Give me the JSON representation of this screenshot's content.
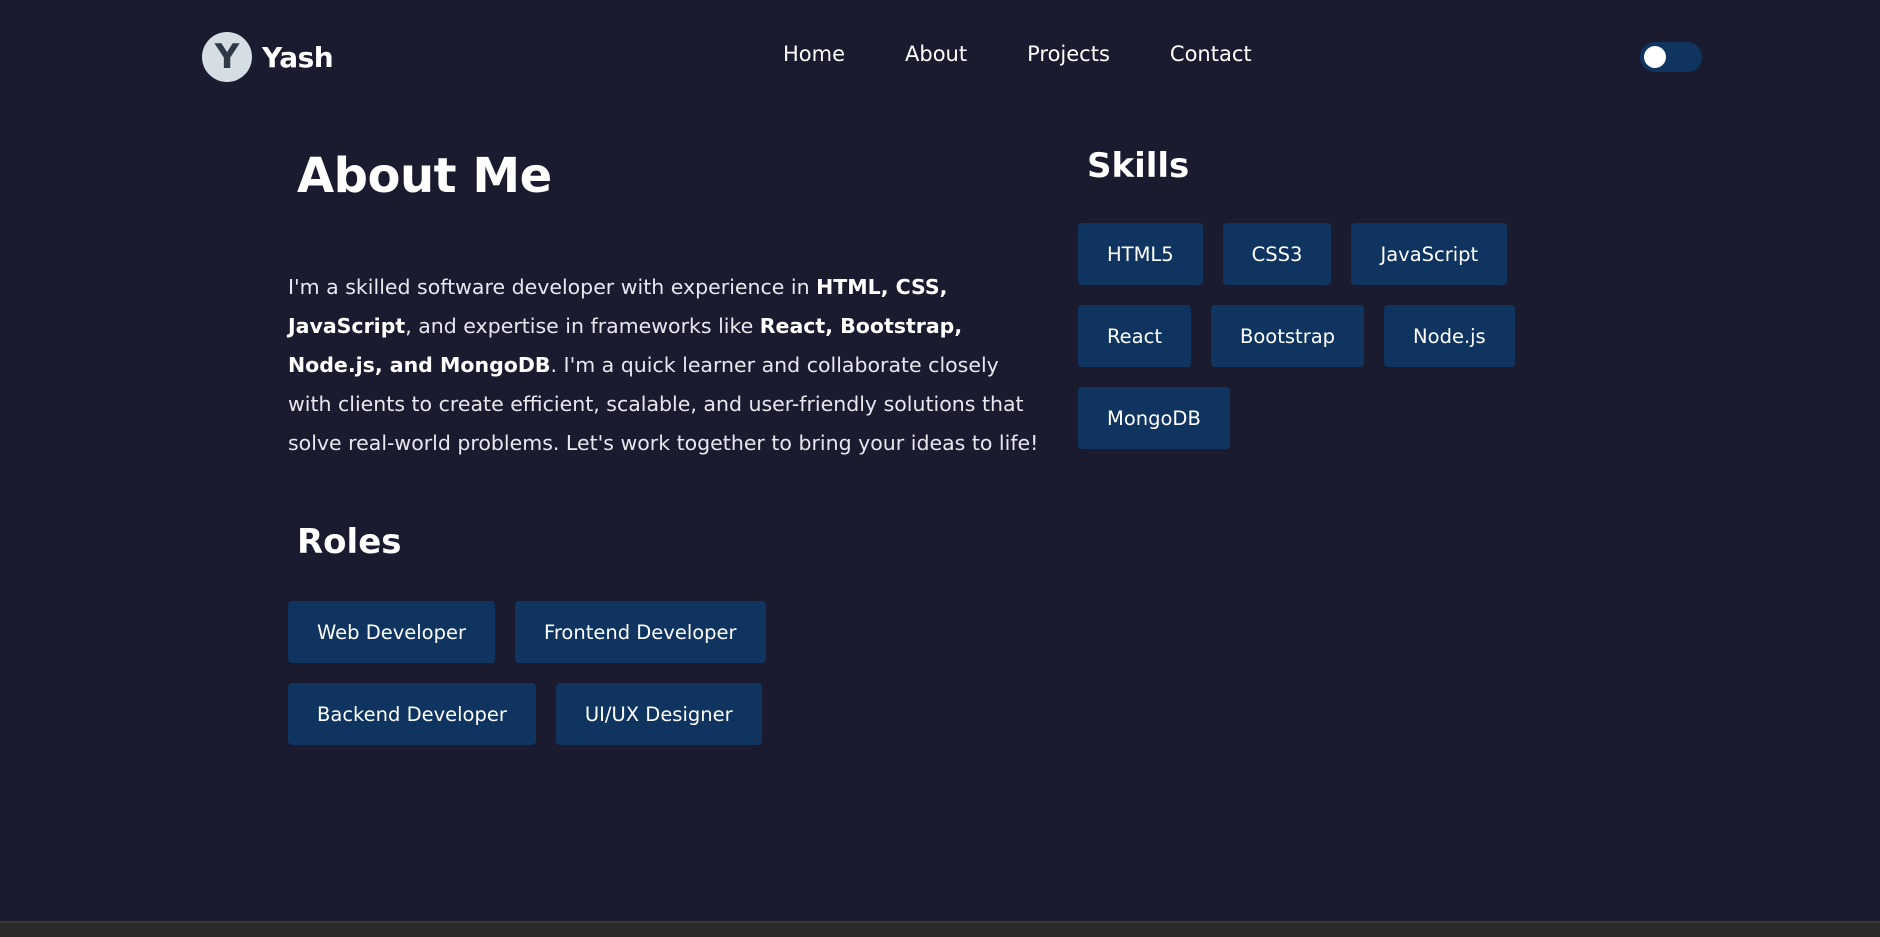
{
  "brand": {
    "logo_letter": "Y",
    "name": "Yash"
  },
  "nav": {
    "links": [
      {
        "label": "Home"
      },
      {
        "label": "About"
      },
      {
        "label": "Projects"
      },
      {
        "label": "Contact"
      }
    ],
    "theme_toggle": {
      "state": "off"
    }
  },
  "about": {
    "title": "About Me",
    "paragraph": [
      {
        "text": "I'm a skilled software developer with experience in ",
        "bold": false
      },
      {
        "text": "HTML, CSS, JavaScript",
        "bold": true
      },
      {
        "text": ", and expertise in frameworks like ",
        "bold": false
      },
      {
        "text": "React, Bootstrap, Node.js, and MongoDB",
        "bold": true
      },
      {
        "text": ". I'm a quick learner and collaborate closely with clients to create efficient, scalable, and user-friendly solutions that solve real-world problems. Let's work together to bring your ideas to life!",
        "bold": false
      }
    ]
  },
  "roles": {
    "title": "Roles",
    "items": [
      "Web Developer",
      "Frontend Developer",
      "Backend Developer",
      "UI/UX Designer"
    ]
  },
  "skills": {
    "title": "Skills",
    "items": [
      "HTML5",
      "CSS3",
      "JavaScript",
      "React",
      "Bootstrap",
      "Node.js",
      "MongoDB"
    ]
  },
  "colors": {
    "background": "#1b1b30",
    "chip": "#0f3460",
    "text": "#ffffff",
    "logo_bg": "#d5dee5"
  }
}
